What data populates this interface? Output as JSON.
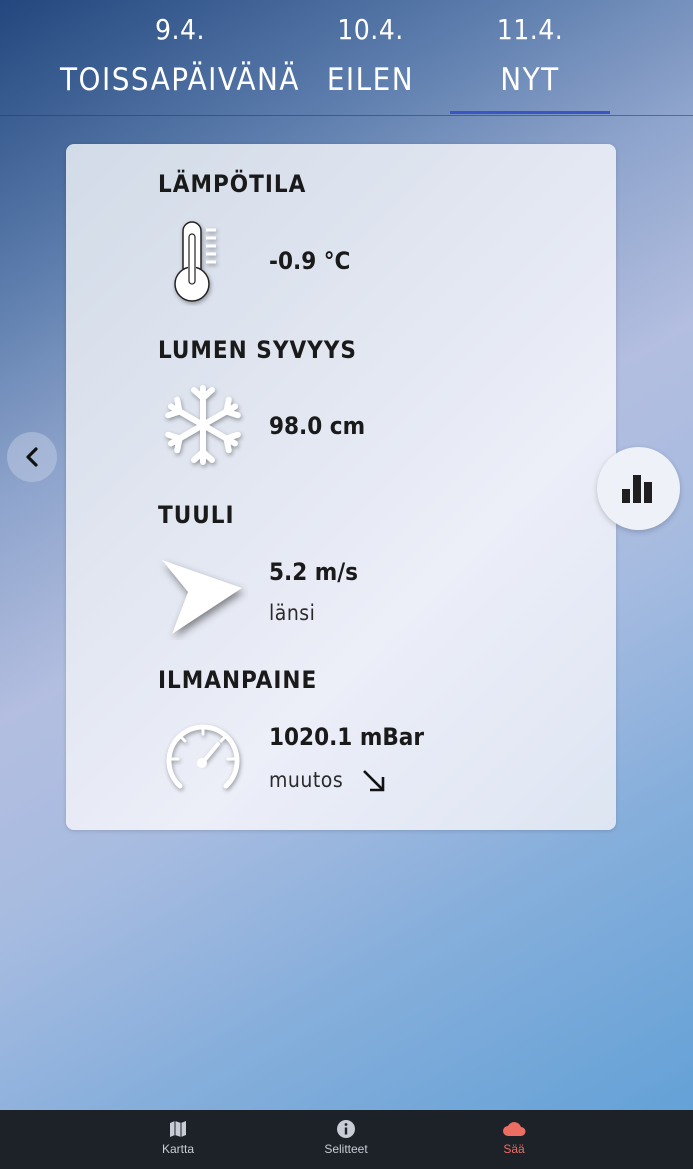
{
  "tabs": [
    {
      "date": "9.4.",
      "name": "TOISSAPÄIVÄNÄ"
    },
    {
      "date": "10.4.",
      "name": "EILEN"
    },
    {
      "date": "11.4.",
      "name": "NYT"
    }
  ],
  "active_tab": "NYT",
  "weather": {
    "temperature": {
      "title": "LÄMPÖTILA",
      "value": "-0.9 °C",
      "icon": "thermometer-icon"
    },
    "snow": {
      "title": "LUMEN SYVYYS",
      "value": "98.0 cm",
      "icon": "snowflake-icon"
    },
    "wind": {
      "title": "TUULI",
      "value": "5.2 m/s",
      "direction": "länsi",
      "icon": "wind-direction-arrow-icon"
    },
    "pressure": {
      "title": "ILMANPAINE",
      "value": "1020.1 mBar",
      "change_label": "muutos",
      "change_icon": "arrow-down-right-icon",
      "icon": "gauge-icon"
    }
  },
  "controls": {
    "previous_icon": "chevron-left-icon",
    "chart_icon": "bar-chart-icon"
  },
  "bottom_nav": [
    {
      "label": "Kartta",
      "icon": "map-icon",
      "color": "#c8ccd4"
    },
    {
      "label": "Selitteet",
      "icon": "info-icon",
      "color": "#c8ccd4"
    },
    {
      "label": "Sää",
      "icon": "cloud-icon",
      "color": "#ec6e63"
    }
  ],
  "colors": {
    "tab_underline": "#3a55c4",
    "active_nav": "#ec6e63",
    "nav_background": "#1d2128"
  }
}
